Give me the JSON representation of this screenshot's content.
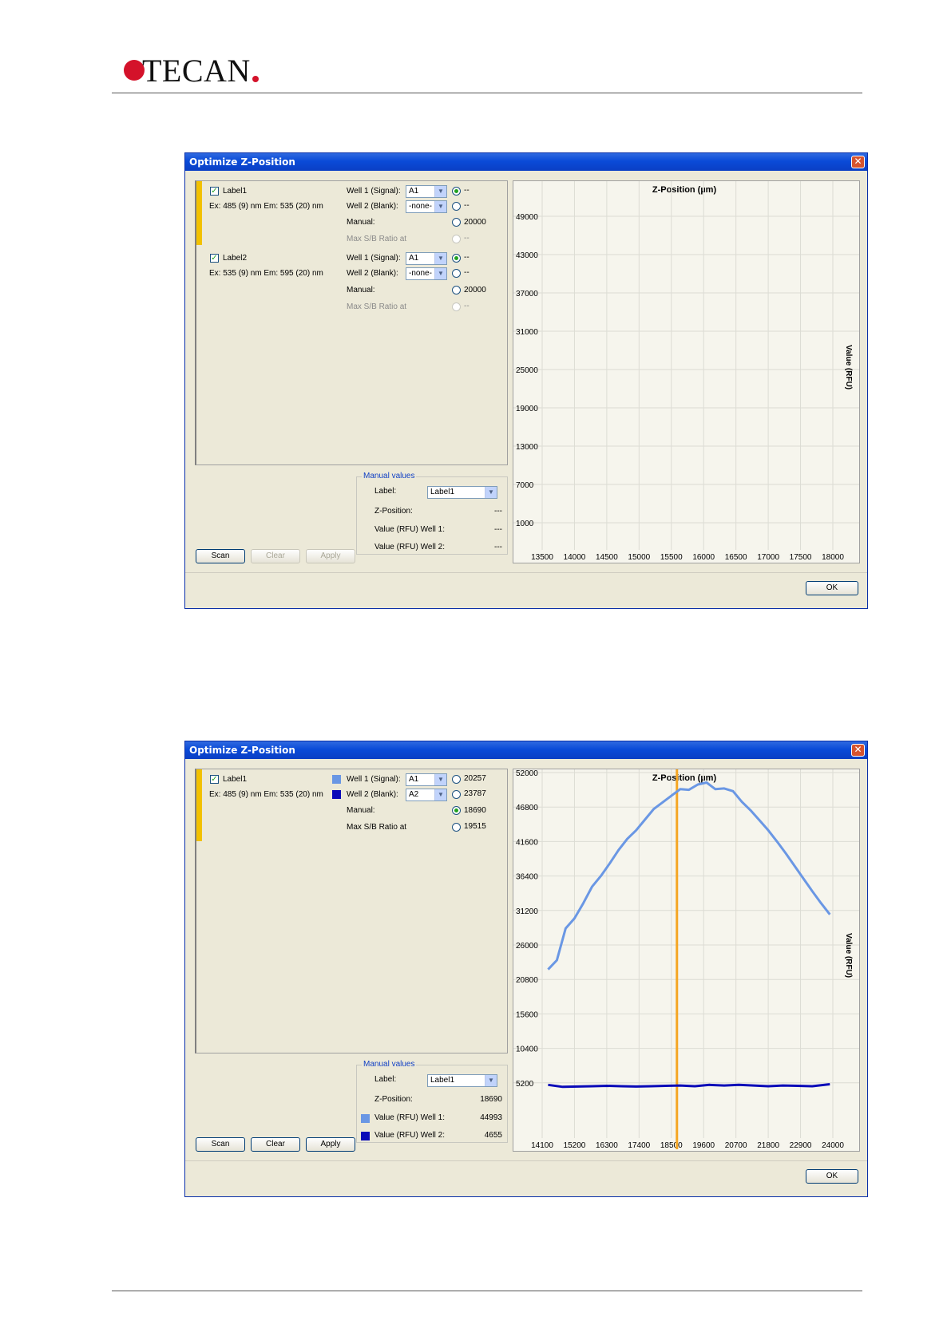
{
  "header": {
    "logo_text": "TECAN"
  },
  "dialogs": [
    {
      "title": "Optimize Z-Position",
      "labels": [
        {
          "name": "Label1",
          "ex_em": "Ex: 485 (9) nm Em: 535 (20) nm",
          "well1_label": "Well 1 (Signal):",
          "well1_value": "A1",
          "well1_result": "--",
          "well2_label": "Well 2 (Blank):",
          "well2_value": "-none-",
          "well2_result": "--",
          "manual_label": "Manual:",
          "manual_value": "20000",
          "maxsb_label": "Max S/B Ratio at",
          "maxsb_value": "--"
        },
        {
          "name": "Label2",
          "ex_em": "Ex: 535 (9) nm Em: 595 (20) nm",
          "well1_label": "Well 1 (Signal):",
          "well1_value": "A1",
          "well1_result": "--",
          "well2_label": "Well 2 (Blank):",
          "well2_value": "-none-",
          "well2_result": "--",
          "manual_label": "Manual:",
          "manual_value": "20000",
          "maxsb_label": "Max S/B Ratio at",
          "maxsb_value": "--"
        }
      ],
      "manual_values": {
        "legend": "Manual values",
        "label_label": "Label:",
        "label_value": "Label1",
        "zpos_label": "Z-Position:",
        "zpos_value": "---",
        "w1_label": "Value (RFU) Well 1:",
        "w1_value": "---",
        "w2_label": "Value (RFU) Well 2:",
        "w2_value": "---"
      },
      "buttons": {
        "scan": "Scan",
        "clear": "Clear",
        "apply": "Apply",
        "ok": "OK"
      },
      "chart_data": {
        "type": "line",
        "title": "Z-Position (µm)",
        "ylabel": "Value (RFU)",
        "x_ticks": [
          "13500",
          "14000",
          "14500",
          "15000",
          "15500",
          "16000",
          "16500",
          "17000",
          "17500",
          "18000"
        ],
        "y_ticks": [
          "49000",
          "43000",
          "37000",
          "31000",
          "25000",
          "19000",
          "13000",
          "7000",
          "1000"
        ],
        "series": [],
        "grid": true
      }
    },
    {
      "title": "Optimize Z-Position",
      "labels": [
        {
          "name": "Label1",
          "ex_em": "Ex: 485 (9) nm Em: 535 (20) nm",
          "well1_label": "Well 1 (Signal):",
          "well1_value": "A1",
          "well1_result": "20257",
          "well2_label": "Well 2 (Blank):",
          "well2_value": "A2",
          "well2_result": "23787",
          "manual_label": "Manual:",
          "manual_value": "18690",
          "maxsb_label": "Max S/B Ratio at",
          "maxsb_value": "19515",
          "well1_color": "#6a97e4",
          "well2_color": "#0a0ab8"
        }
      ],
      "manual_values": {
        "legend": "Manual values",
        "label_label": "Label:",
        "label_value": "Label1",
        "zpos_label": "Z-Position:",
        "zpos_value": "18690",
        "w1_label": "Value (RFU) Well 1:",
        "w1_value": "44993",
        "w2_label": "Value (RFU) Well 2:",
        "w2_value": "4655"
      },
      "buttons": {
        "scan": "Scan",
        "clear": "Clear",
        "apply": "Apply",
        "ok": "OK"
      },
      "chart_data": {
        "type": "line",
        "title": "Z-Position (µm)",
        "ylabel": "Value (RFU)",
        "x_ticks": [
          "14100",
          "15200",
          "16300",
          "17400",
          "18500",
          "19600",
          "20700",
          "21800",
          "22900",
          "24000"
        ],
        "y_ticks": [
          "52000",
          "46800",
          "41600",
          "36400",
          "31200",
          "26000",
          "20800",
          "15600",
          "10400",
          "5200"
        ],
        "xlim": [
          14100,
          24000
        ],
        "ylim": [
          5200,
          52000
        ],
        "marker_x": 18690,
        "marker_color": "#f5a623",
        "series": [
          {
            "color": "#6a97e4",
            "x": [
              14300,
              14600,
              14900,
              15200,
              15500,
              15800,
              16100,
              16400,
              16700,
              17000,
              17300,
              17600,
              17900,
              18200,
              18500,
              18800,
              19100,
              19400,
              19700,
              20000,
              20300,
              20600,
              20900,
              21200,
              21500,
              21800,
              22100,
              22400,
              22700,
              23000,
              23300,
              23600,
              23900
            ],
            "y": [
              22300,
              23700,
              28500,
              30000,
              32300,
              34800,
              36400,
              38300,
              40300,
              42000,
              43300,
              44900,
              46500,
              47500,
              48500,
              49500,
              49400,
              50200,
              50500,
              49500,
              49600,
              49200,
              47600,
              46300,
              44800,
              43300,
              41600,
              39800,
              37900,
              36000,
              34100,
              32300,
              30600
            ]
          },
          {
            "color": "#0a0ab8",
            "x": [
              14300,
              14800,
              15300,
              15800,
              16300,
              16800,
              17300,
              17800,
              18300,
              18800,
              19300,
              19800,
              20300,
              20800,
              21300,
              21800,
              22300,
              22800,
              23300,
              23900
            ],
            "y": [
              4900,
              4600,
              4650,
              4700,
              4750,
              4700,
              4650,
              4700,
              4750,
              4800,
              4700,
              4900,
              4800,
              4900,
              4800,
              4700,
              4800,
              4750,
              4700,
              5000
            ]
          }
        ],
        "grid": true
      }
    }
  ]
}
